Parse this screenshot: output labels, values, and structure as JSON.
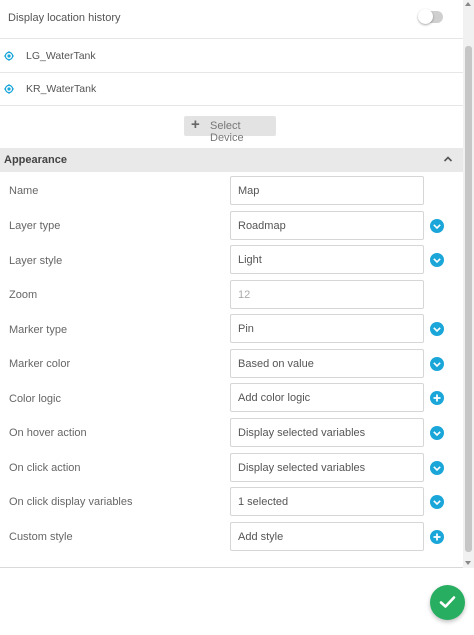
{
  "location_history": {
    "label": "Display location history",
    "enabled": false
  },
  "devices": [
    {
      "name": "LG_WaterTank",
      "icon": "location-target-icon"
    },
    {
      "name": "KR_WaterTank",
      "icon": "location-target-icon"
    }
  ],
  "select_device": {
    "label": "Select Device",
    "icon": "plus-icon"
  },
  "appearance": {
    "title": "Appearance",
    "fields": [
      {
        "label": "Name",
        "value": "Map",
        "kind": "text"
      },
      {
        "label": "Layer type",
        "value": "Roadmap",
        "kind": "select"
      },
      {
        "label": "Layer style",
        "value": "Light",
        "kind": "select"
      },
      {
        "label": "Zoom",
        "placeholder": "12",
        "kind": "number"
      },
      {
        "label": "Marker type",
        "value": "Pin",
        "kind": "select"
      },
      {
        "label": "Marker color",
        "value": "Based on value",
        "kind": "select"
      },
      {
        "label": "Color logic",
        "value": "Add color logic",
        "kind": "add"
      },
      {
        "label": "On hover action",
        "value": "Display selected variables",
        "kind": "select"
      },
      {
        "label": "On click action",
        "value": "Display selected variables",
        "kind": "select"
      },
      {
        "label": "On click display variables",
        "value": "1 selected",
        "kind": "select"
      },
      {
        "label": "Custom style",
        "value": "Add style",
        "kind": "add"
      }
    ]
  },
  "colors": {
    "accent": "#1aa6d9",
    "confirm": "#27ae60",
    "section_bg": "#e9e9e9"
  },
  "confirm_button": {
    "icon": "checkmark-icon"
  }
}
